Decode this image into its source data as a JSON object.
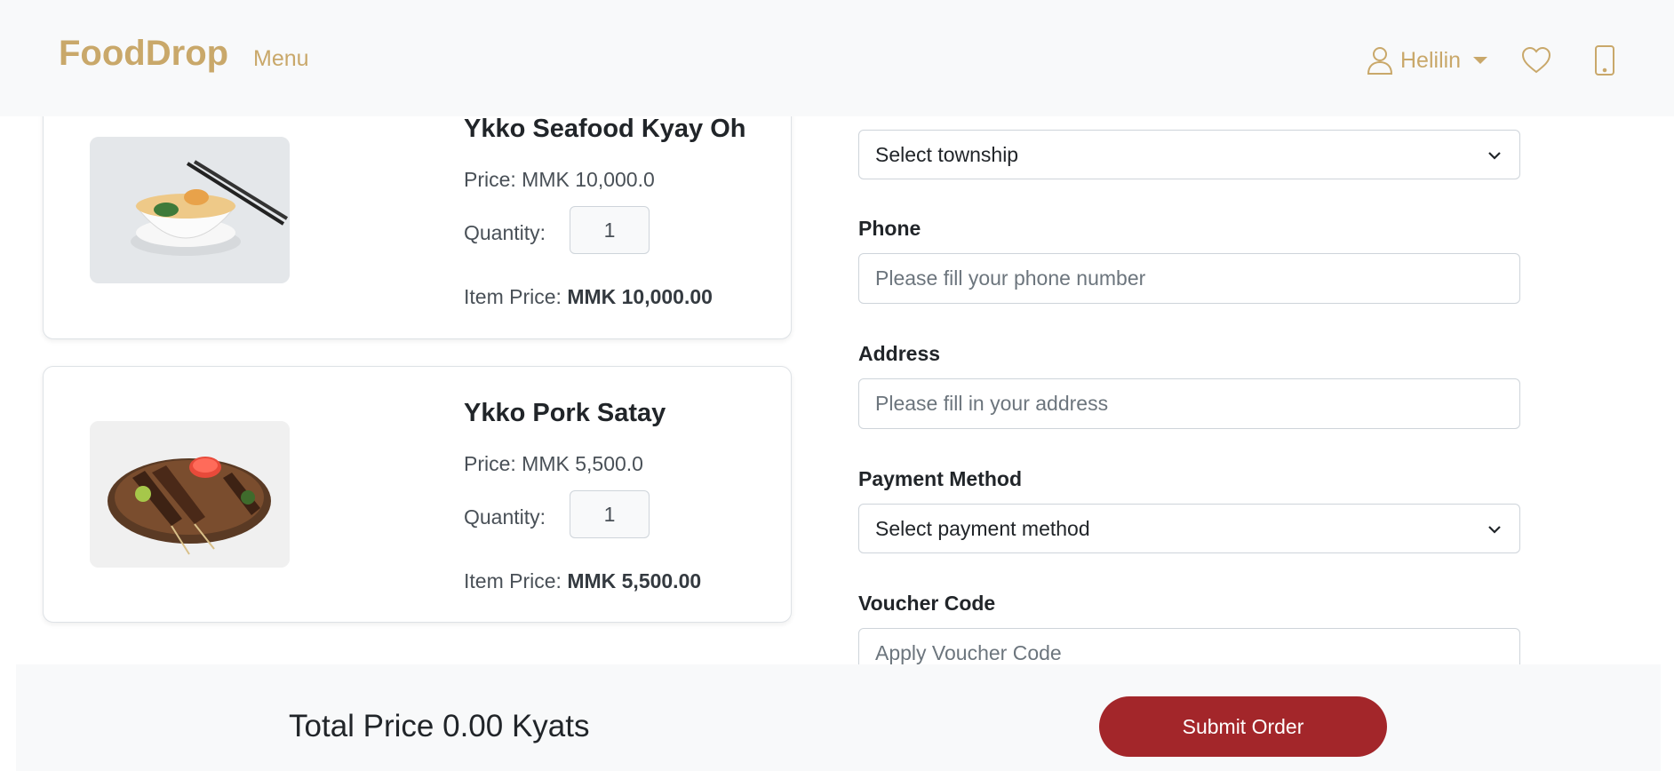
{
  "header": {
    "brand": "FoodDrop",
    "menu_label": "Menu",
    "user_name": "Helilin",
    "icons": [
      "user-icon",
      "heart-icon",
      "phone-icon"
    ],
    "brand_color": "#c9a86a"
  },
  "cart_items": [
    {
      "name": "Ykko Seafood Kyay Oh",
      "price_text": "Price: MMK 10,000.0",
      "quantity_label": "Quantity:",
      "quantity_value": "1",
      "item_price_label": "Item Price:",
      "item_price_value": "MMK 10,000.00"
    },
    {
      "name": "Ykko Pork Satay",
      "price_text": "Price: MMK 5,500.0",
      "quantity_label": "Quantity:",
      "quantity_value": "1",
      "item_price_label": "Item Price:",
      "item_price_value": "MMK 5,500.00"
    }
  ],
  "form": {
    "township_select": "Select township",
    "phone_label": "Phone",
    "phone_placeholder": "Please fill your phone number",
    "address_label": "Address",
    "address_placeholder": "Please fill in your address",
    "payment_label": "Payment Method",
    "payment_select": "Select payment method",
    "voucher_label": "Voucher Code",
    "voucher_placeholder": "Apply Voucher Code"
  },
  "footer": {
    "total_text": "Total Price 0.00 Kyats",
    "submit_label": "Submit Order",
    "submit_color": "#a3262a"
  }
}
